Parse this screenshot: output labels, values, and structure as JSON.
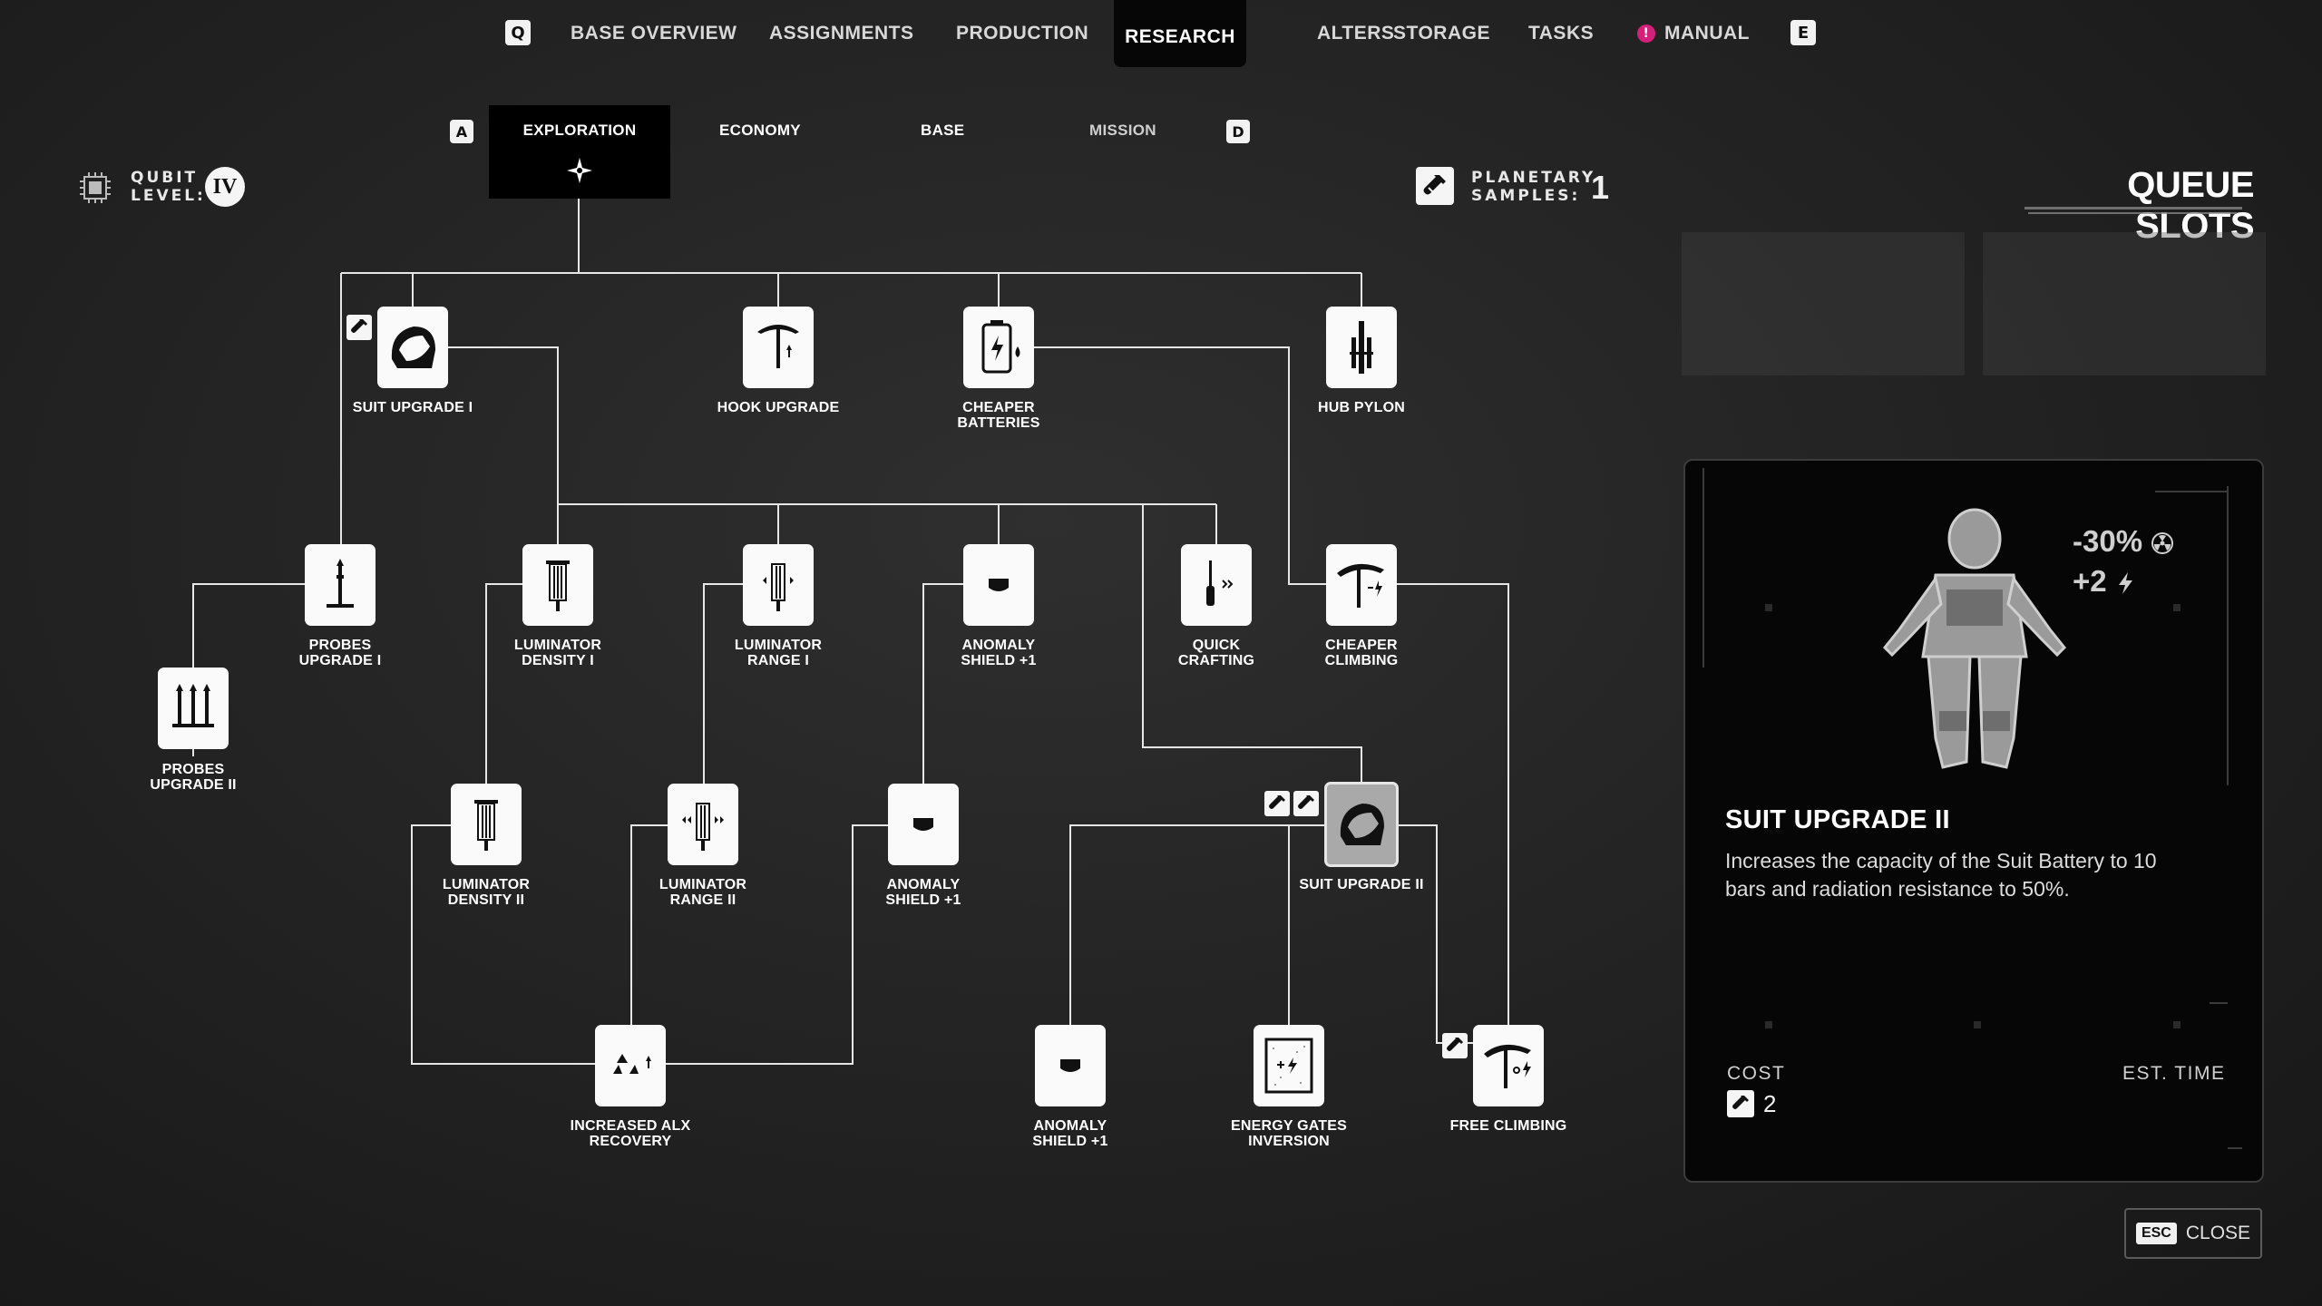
{
  "nav": {
    "key_left": "Q",
    "key_right": "E",
    "items": [
      {
        "label": "BASE OVERVIEW"
      },
      {
        "label": "ASSIGNMENTS"
      },
      {
        "label": "PRODUCTION"
      },
      {
        "label": "RESEARCH",
        "active": true
      },
      {
        "label": "ALTERS"
      },
      {
        "label": "STORAGE"
      },
      {
        "label": "TASKS"
      },
      {
        "label": "MANUAL",
        "badge": "!"
      }
    ]
  },
  "subtabs": {
    "key_left": "A",
    "key_right": "D",
    "items": [
      {
        "label": "EXPLORATION",
        "active": true
      },
      {
        "label": "ECONOMY"
      },
      {
        "label": "BASE"
      },
      {
        "label": "MISSION"
      }
    ]
  },
  "qubit": {
    "label_line1": "QUBIT",
    "label_line2": "LEVEL:",
    "value": "IV"
  },
  "samples": {
    "label_line1": "PLANETARY",
    "label_line2": "SAMPLES:",
    "value": "1"
  },
  "queue": {
    "title": "QUEUE SLOTS",
    "slots": 2
  },
  "tree": {
    "nodes": [
      {
        "id": "suit1",
        "line1": "SUIT UPGRADE I",
        "line2": "",
        "icon": "helmet-icon",
        "samples": 1
      },
      {
        "id": "hook",
        "line1": "HOOK UPGRADE",
        "line2": "",
        "icon": "grapple-hook-icon"
      },
      {
        "id": "batt",
        "line1": "CHEAPER",
        "line2": "BATTERIES",
        "icon": "battery-icon"
      },
      {
        "id": "pylon",
        "line1": "HUB PYLON",
        "line2": "",
        "icon": "pylon-icon"
      },
      {
        "id": "probe1",
        "line1": "PROBES",
        "line2": "UPGRADE I",
        "icon": "probe-icon"
      },
      {
        "id": "lumd1",
        "line1": "LUMINATOR",
        "line2": "DENSITY I",
        "icon": "luminator-density-icon"
      },
      {
        "id": "lumr1",
        "line1": "LUMINATOR",
        "line2": "RANGE I",
        "icon": "luminator-range-icon"
      },
      {
        "id": "shield1",
        "line1": "ANOMALY",
        "line2": "SHIELD +1",
        "icon": "shield-icon"
      },
      {
        "id": "craft",
        "line1": "QUICK",
        "line2": "CRAFTING",
        "icon": "screwdriver-icon"
      },
      {
        "id": "climb",
        "line1": "CHEAPER",
        "line2": "CLIMBING",
        "icon": "pickaxe-icon"
      },
      {
        "id": "probe2",
        "line1": "PROBES",
        "line2": "UPGRADE II",
        "icon": "probes-icon"
      },
      {
        "id": "lumd2",
        "line1": "LUMINATOR",
        "line2": "DENSITY II",
        "icon": "luminator-density-icon"
      },
      {
        "id": "lumr2",
        "line1": "LUMINATOR",
        "line2": "RANGE II",
        "icon": "luminator-range-icon"
      },
      {
        "id": "shield2",
        "line1": "ANOMALY",
        "line2": "SHIELD +1",
        "icon": "shield-icon"
      },
      {
        "id": "suit2",
        "line1": "SUIT UPGRADE II",
        "line2": "",
        "icon": "helmet-icon",
        "samples": 2,
        "selected": true
      },
      {
        "id": "alx",
        "line1": "INCREASED ALX",
        "line2": "RECOVERY",
        "icon": "alx-icon"
      },
      {
        "id": "shield3",
        "line1": "ANOMALY",
        "line2": "SHIELD +1",
        "icon": "shield-icon"
      },
      {
        "id": "gates",
        "line1": "ENERGY GATES",
        "line2": "INVERSION",
        "icon": "energy-gate-icon"
      },
      {
        "id": "freeclimb",
        "line1": "FREE CLIMBING",
        "line2": "",
        "icon": "pickaxe-bolt-icon",
        "samples": 1
      }
    ]
  },
  "detail": {
    "stat1": "-30%",
    "stat2": "+2",
    "title": "SUIT UPGRADE II",
    "description": "Increases the capacity of the Suit Battery to 10 bars and radiation resistance to 50%.",
    "cost_label": "COST",
    "cost_value": "2",
    "time_label": "EST. TIME"
  },
  "close": {
    "key": "ESC",
    "label": "CLOSE"
  }
}
